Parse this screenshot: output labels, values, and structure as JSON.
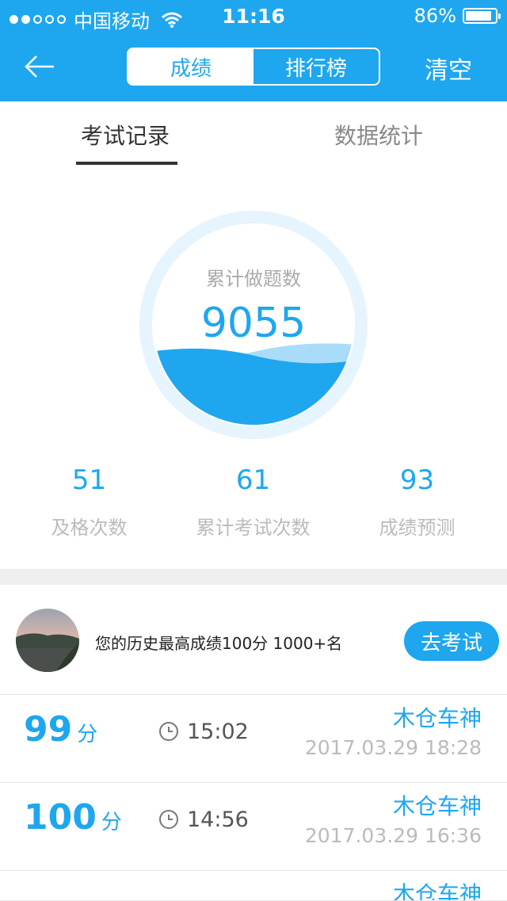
{
  "status": {
    "carrier": "中国移动",
    "time": "11:16",
    "battery": "86%"
  },
  "nav": {
    "tab_scores": "成绩",
    "tab_rank": "排行榜",
    "clear": "清空"
  },
  "tabs": {
    "records": "考试记录",
    "stats": "数据统计"
  },
  "summary": {
    "total_label": "累计做题数",
    "total_value": "9055",
    "pass_count": "51",
    "pass_label": "及格次数",
    "exam_count": "61",
    "exam_label": "累计考试次数",
    "predict_value": "93",
    "predict_label": "成绩预测"
  },
  "best": {
    "text": "您的历史最高成绩100分  1000+名",
    "button": "去考试"
  },
  "records": [
    {
      "score": "99",
      "unit": "分",
      "duration": "15:02",
      "name": "木仓车神",
      "date": "2017.03.29 18:28"
    },
    {
      "score": "100",
      "unit": "分",
      "duration": "14:56",
      "name": "木仓车神",
      "date": "2017.03.29 16:36"
    },
    {
      "score": "",
      "unit": "",
      "duration": "",
      "name": "木仓车神",
      "date": ""
    }
  ],
  "colors": {
    "accent": "#1ea7ef",
    "wave_light": "#a9dcf8",
    "ring": "#e6f4fd"
  },
  "icons": [
    "back-arrow-icon",
    "wifi-icon",
    "battery-icon",
    "clock-icon"
  ]
}
